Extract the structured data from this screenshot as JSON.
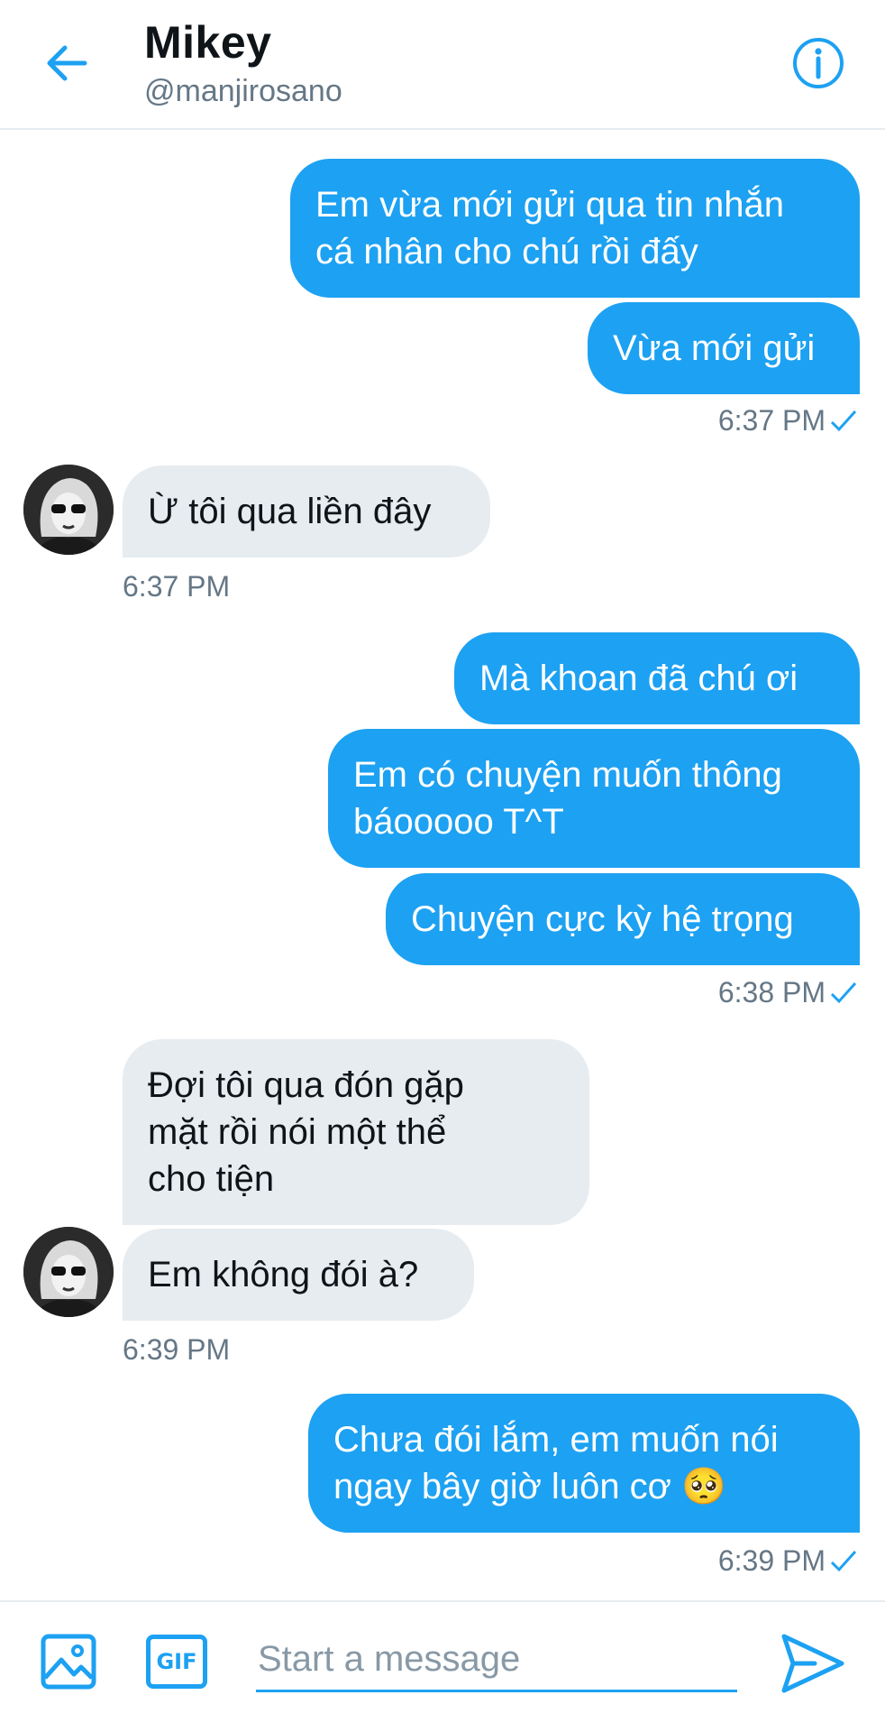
{
  "header": {
    "name": "Mikey",
    "handle": "@manjirosano",
    "back_icon": "arrow-left-icon",
    "info_icon": "info-circle-icon"
  },
  "messages": [
    {
      "direction": "out",
      "lines": [
        "Em vừa mới gửi qua tin nhắn",
        "cá nhân cho chú rồi đấy"
      ]
    },
    {
      "direction": "out",
      "lines": [
        "Vừa mới gửi"
      ]
    },
    {
      "type": "time",
      "direction": "out",
      "text": "6:37 PM",
      "read": true
    },
    {
      "direction": "in",
      "lines": [
        "Ừ tôi qua liền đây"
      ]
    },
    {
      "type": "time",
      "direction": "in",
      "text": "6:37 PM"
    },
    {
      "direction": "out",
      "lines": [
        "Mà khoan đã chú ơi"
      ]
    },
    {
      "direction": "out",
      "lines": [
        "Em có chuyện muốn thông",
        "báooooo T^T"
      ]
    },
    {
      "direction": "out",
      "lines": [
        "Chuyện cực kỳ hệ trọng"
      ]
    },
    {
      "type": "time",
      "direction": "out",
      "text": "6:38 PM",
      "read": true
    },
    {
      "direction": "in",
      "lines": [
        "Đợi tôi qua đón gặp",
        "mặt rồi nói một thể",
        "cho tiện"
      ]
    },
    {
      "direction": "in",
      "lines": [
        "Em không đói à?"
      ]
    },
    {
      "type": "time",
      "direction": "in",
      "text": "6:39 PM"
    },
    {
      "direction": "out",
      "lines": [
        "Chưa đói lắm, em muốn nói",
        "ngay bây giờ luôn cơ 🥺"
      ]
    },
    {
      "type": "time",
      "direction": "out",
      "text": "6:39 PM",
      "read": true
    }
  ],
  "composer": {
    "placeholder": "Start a message",
    "gif_label": "GIF",
    "media_icon": "image-icon",
    "send_icon": "send-icon"
  },
  "colors": {
    "accent": "#1da1f2",
    "incoming_bubble": "#e6ecf0",
    "secondary_text": "#657786"
  }
}
